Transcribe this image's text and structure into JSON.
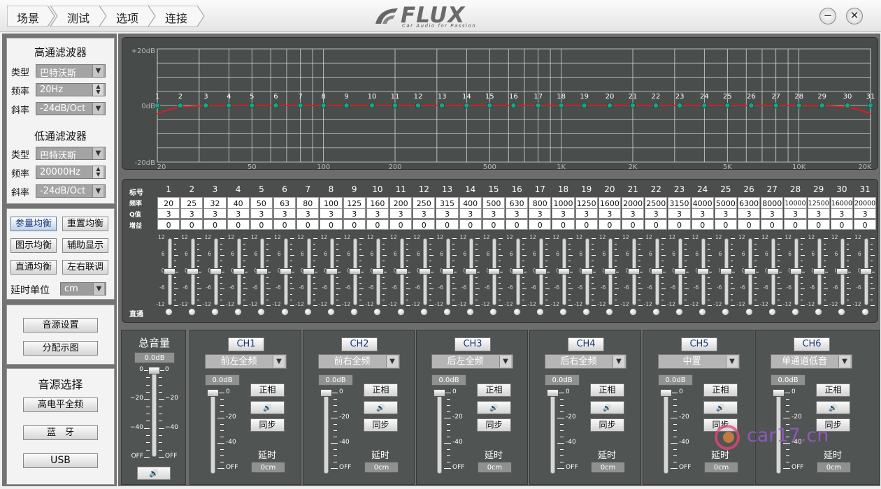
{
  "breadcrumbs": [
    "场景",
    "测试",
    "选项",
    "连接"
  ],
  "logo": {
    "text": "FLUX",
    "tagline": "Car Audio for Passion"
  },
  "window_buttons": {
    "minimize": "−",
    "close": "✕"
  },
  "hpf": {
    "title": "高通滤波器",
    "type_label": "类型",
    "type_value": "巴特沃斯",
    "freq_label": "频率",
    "freq_value": "20Hz",
    "slope_label": "斜率",
    "slope_value": "-24dB/Oct"
  },
  "lpf": {
    "title": "低通滤波器",
    "type_label": "类型",
    "type_value": "巴特沃斯",
    "freq_label": "频率",
    "freq_value": "20000Hz",
    "slope_label": "斜率",
    "slope_value": "-24dB/Oct"
  },
  "eq_buttons": [
    {
      "label": "参量均衡",
      "active": true
    },
    {
      "label": "重置均衡",
      "active": false
    },
    {
      "label": "图示均衡",
      "active": false
    },
    {
      "label": "辅助显示",
      "active": false
    },
    {
      "label": "直通均衡",
      "active": false
    },
    {
      "label": "左右联调",
      "active": false
    }
  ],
  "delay_unit": {
    "label": "延时单位",
    "value": "cm"
  },
  "source_buttons": [
    "音源设置",
    "分配示图"
  ],
  "source_select": {
    "title": "音源选择",
    "options": [
      "高电平全频",
      "蓝　牙",
      "USB"
    ]
  },
  "eq_graph": {
    "y_labels": [
      "+20dB",
      "0dB",
      "-20dB"
    ],
    "x_labels": [
      "20",
      "50",
      "100",
      "200",
      "500",
      "1K",
      "2K",
      "5K",
      "10K",
      "20K"
    ],
    "point_labels": [
      "1",
      "2",
      "3",
      "4",
      "5",
      "6",
      "7",
      "8",
      "9",
      "10",
      "11",
      "12",
      "13",
      "14",
      "15",
      "16",
      "17",
      "18",
      "19",
      "20",
      "21",
      "22",
      "23",
      "24",
      "25",
      "26",
      "27",
      "28",
      "29",
      "30",
      "31"
    ]
  },
  "band_table": {
    "row_labels": [
      "标号",
      "频率",
      "Q值",
      "增益"
    ],
    "numbers": [
      "1",
      "2",
      "3",
      "4",
      "5",
      "6",
      "7",
      "8",
      "9",
      "10",
      "11",
      "12",
      "13",
      "14",
      "15",
      "16",
      "17",
      "18",
      "19",
      "20",
      "21",
      "22",
      "23",
      "24",
      "25",
      "26",
      "27",
      "28",
      "29",
      "30",
      "31"
    ],
    "freqs": [
      "20",
      "25",
      "32",
      "40",
      "50",
      "63",
      "80",
      "100",
      "125",
      "160",
      "200",
      "250",
      "315",
      "400",
      "500",
      "630",
      "800",
      "1000",
      "1250",
      "1600",
      "2000",
      "2500",
      "3150",
      "4000",
      "5000",
      "6300",
      "8000",
      "10000",
      "12500",
      "16000",
      "20000"
    ],
    "q": [
      "3",
      "3",
      "3",
      "3",
      "3",
      "3",
      "3",
      "3",
      "3",
      "3",
      "3",
      "3",
      "3",
      "3",
      "3",
      "3",
      "3",
      "3",
      "3",
      "3",
      "3",
      "3",
      "3",
      "3",
      "3",
      "3",
      "3",
      "3",
      "3",
      "3",
      "3"
    ],
    "gain": [
      "0",
      "0",
      "0",
      "0",
      "0",
      "0",
      "0",
      "0",
      "0",
      "0",
      "0",
      "0",
      "0",
      "0",
      "0",
      "0",
      "0",
      "0",
      "0",
      "0",
      "0",
      "0",
      "0",
      "0",
      "0",
      "0",
      "0",
      "0",
      "0",
      "0",
      "0"
    ],
    "scale": [
      "12",
      "6",
      "0",
      "-6",
      "-12"
    ],
    "bypass_label": "直通"
  },
  "master": {
    "title": "总音量",
    "value": "0.0dB",
    "scale": [
      "0",
      "−20",
      "−40",
      "OFF"
    ],
    "level_db": 0
  },
  "channels": [
    {
      "name": "CH1",
      "assign": "前左全频",
      "value": "0.0dB",
      "phase": "正相",
      "mute": "🔊",
      "sync": "同步",
      "delay_label": "延时",
      "delay": "0cm"
    },
    {
      "name": "CH2",
      "assign": "前右全频",
      "value": "0.0dB",
      "phase": "正相",
      "mute": "🔊",
      "sync": "同步",
      "delay_label": "延时",
      "delay": "0cm"
    },
    {
      "name": "CH3",
      "assign": "后左全频",
      "value": "0.0dB",
      "phase": "正相",
      "mute": "🔊",
      "sync": "同步",
      "delay_label": "延时",
      "delay": "0cm"
    },
    {
      "name": "CH4",
      "assign": "后右全频",
      "value": "0.0dB",
      "phase": "正相",
      "mute": "🔊",
      "sync": "同步",
      "delay_label": "延时",
      "delay": "0cm"
    },
    {
      "name": "CH5",
      "assign": "中置",
      "value": "0.0dB",
      "phase": "正相",
      "mute": "🔊",
      "sync": "同步",
      "delay_label": "延时",
      "delay": "0cm"
    },
    {
      "name": "CH6",
      "assign": "单通道低音",
      "value": "0.0dB",
      "phase": "正相",
      "mute": "🔊",
      "sync": "同步",
      "delay_label": "延时",
      "delay": "0cm"
    }
  ],
  "ch_scale": [
    "0",
    "-20",
    "-40",
    "OFF"
  ],
  "watermark": "car17.cn",
  "colors": {
    "curve": "#d42020",
    "point": "#1aa38a",
    "panel": "#4b4e4d"
  }
}
